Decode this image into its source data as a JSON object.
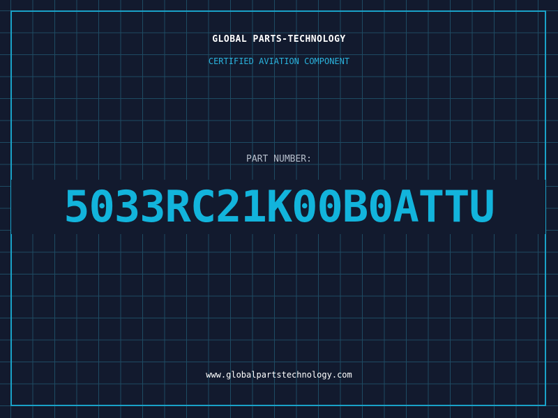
{
  "header": {
    "brand": "GLOBAL PARTS-TECHNOLOGY",
    "subtitle": "CERTIFIED AVIATION COMPONENT"
  },
  "main": {
    "label": "PART NUMBER:",
    "part_number": "5033RC21K00B0ATTU"
  },
  "footer": {
    "url": "www.globalpartstechnology.com"
  },
  "colors": {
    "background": "#121a2e",
    "grid": "#1e4b63",
    "accent": "#12b4dc",
    "frame": "#1aa2c8",
    "text": "#ffffff"
  }
}
